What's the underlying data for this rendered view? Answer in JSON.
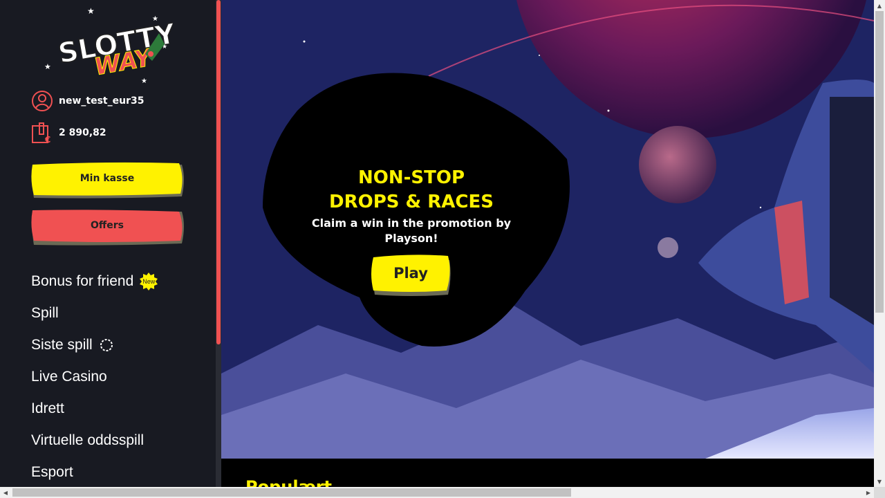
{
  "brand": {
    "logo_line1": "SLOTTY",
    "logo_line2": "WAY"
  },
  "account": {
    "username": "new_test_eur35",
    "balance": "2 890,82"
  },
  "buttons": {
    "cashier": "Min kasse",
    "offers": "Offers"
  },
  "menu": [
    {
      "label": "Bonus for friend",
      "badge": "New"
    },
    {
      "label": "Spill"
    },
    {
      "label": "Siste spill"
    },
    {
      "label": "Live Casino"
    },
    {
      "label": "Idrett"
    },
    {
      "label": "Virtuelle oddsspill"
    },
    {
      "label": "Esport"
    }
  ],
  "promo": {
    "title_line1": "NON-STOP",
    "title_line2": "DROPS & RACES",
    "subtitle": "Claim a win in the promotion by Playson!",
    "cta": "Play"
  },
  "section": {
    "title": "Populært"
  },
  "colors": {
    "accent_yellow": "#fff200",
    "accent_red": "#f05152",
    "sidebar_bg": "#181a22"
  }
}
